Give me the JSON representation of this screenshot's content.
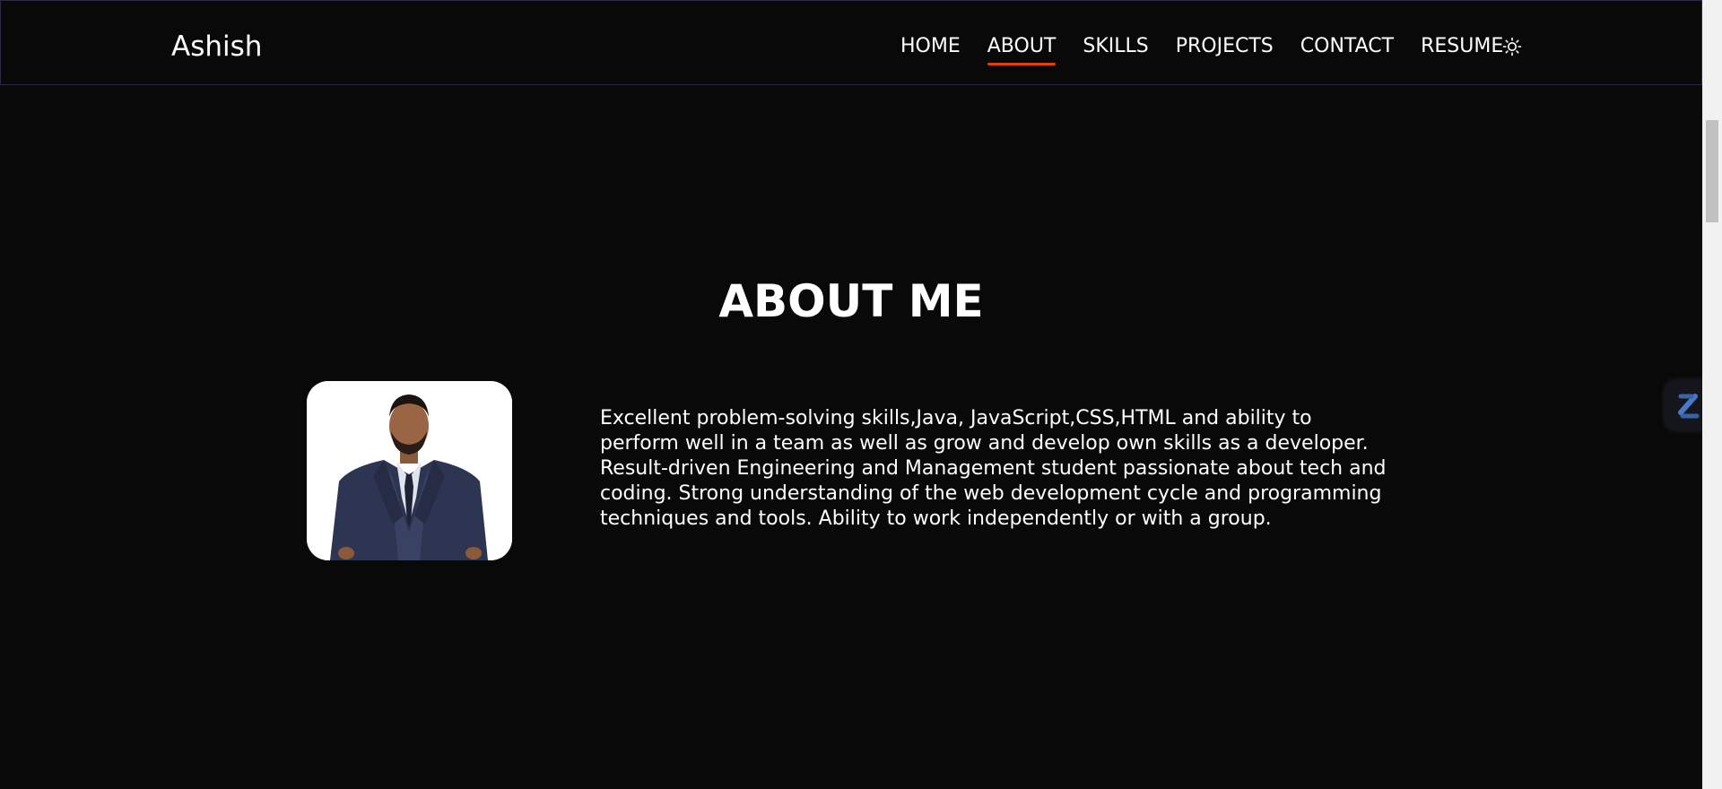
{
  "nav": {
    "brand": "Ashish",
    "links": [
      {
        "label": "HOME",
        "active": false
      },
      {
        "label": "ABOUT",
        "active": true
      },
      {
        "label": "SKILLS",
        "active": false
      },
      {
        "label": "PROJECTS",
        "active": false
      },
      {
        "label": "CONTACT",
        "active": false
      },
      {
        "label": "RESUME",
        "active": false
      }
    ],
    "theme_icon": "sun-icon"
  },
  "about": {
    "title": "ABOUT ME",
    "description": "Excellent problem-solving skills,Java, JavaScript,CSS,HTML and ability to perform well in a team as well as grow and develop own skills as a developer. Result-driven Engineering and Management student passionate about tech and coding. Strong understanding of the web development cycle and programming techniques and tools. Ability to work independently or with a group.",
    "photo_icon": "profile-photo"
  },
  "widget": {
    "icon": "extension-widget-icon"
  },
  "colors": {
    "background": "#0a090a",
    "accent": "#e0400a",
    "nav_border": "#2b2a45",
    "text": "#ffffff"
  }
}
